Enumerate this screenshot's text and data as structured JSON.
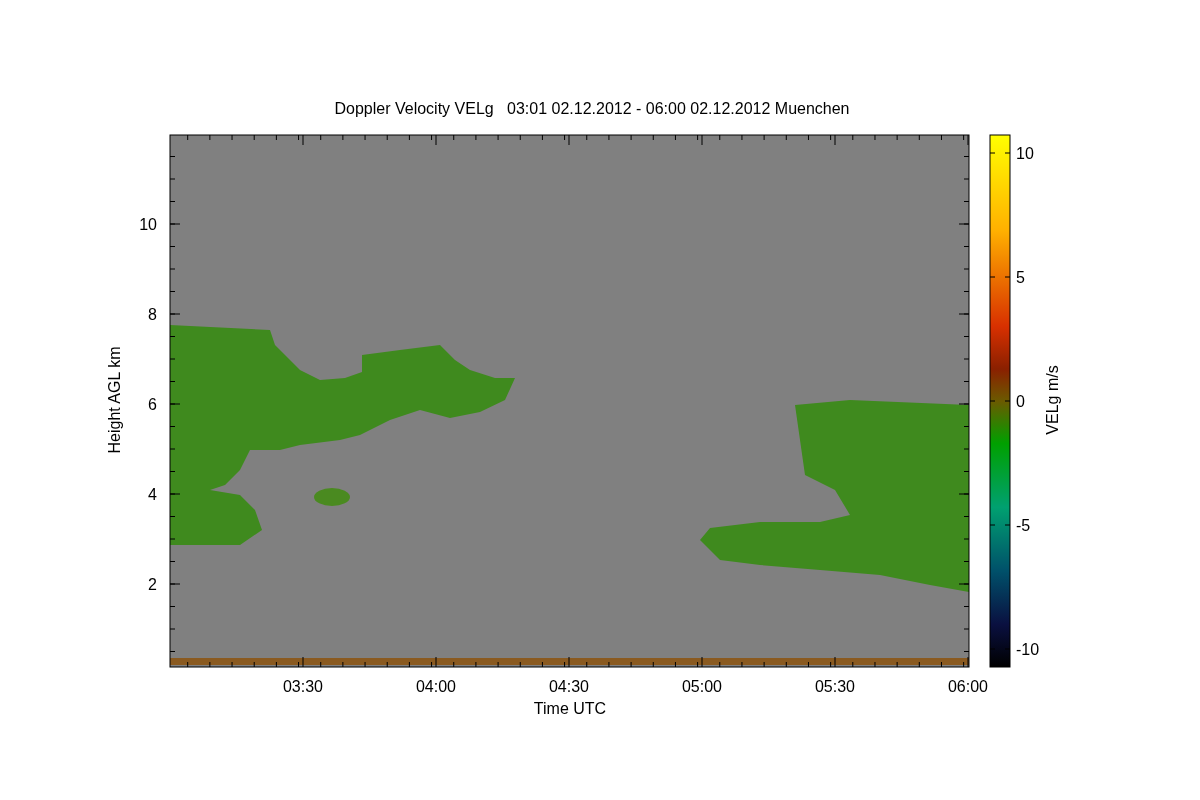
{
  "title": "Doppler Velocity VELg   03:01 02.12.2012 - 06:00 02.12.2012 Muenchen",
  "y_axis": {
    "label": "Height AGL km",
    "ticks": [
      "10",
      "8",
      "6",
      "4",
      "2"
    ]
  },
  "x_axis": {
    "label": "Time UTC",
    "ticks": [
      "03:30",
      "04:00",
      "04:30",
      "05:00",
      "05:30",
      "06:00"
    ]
  },
  "colorbar": {
    "label": "VELg m/s",
    "ticks": [
      "10",
      "5",
      "0",
      "-5",
      "-10"
    ]
  }
}
